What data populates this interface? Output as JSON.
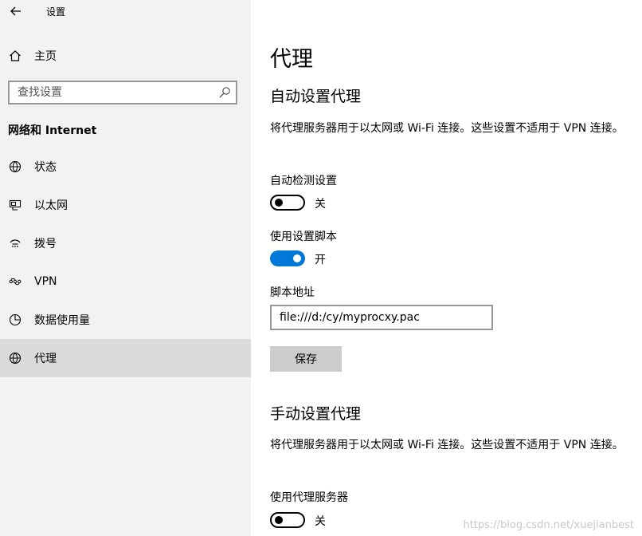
{
  "app": {
    "title": "设置"
  },
  "sidebar": {
    "home_label": "主页",
    "search_placeholder": "查找设置",
    "section_title": "网络和 Internet",
    "items": [
      {
        "label": "状态",
        "icon": "globe-status-icon"
      },
      {
        "label": "以太网",
        "icon": "ethernet-icon"
      },
      {
        "label": "拨号",
        "icon": "dialup-icon"
      },
      {
        "label": "VPN",
        "icon": "vpn-icon"
      },
      {
        "label": "数据使用量",
        "icon": "data-usage-icon"
      },
      {
        "label": "代理",
        "icon": "globe-icon",
        "active": true
      }
    ]
  },
  "main": {
    "title": "代理",
    "auto": {
      "heading": "自动设置代理",
      "description": "将代理服务器用于以太网或 Wi-Fi 连接。这些设置不适用于 VPN 连接。",
      "detect_label": "自动检测设置",
      "detect_state": "关",
      "script_label": "使用设置脚本",
      "script_state": "开",
      "address_label": "脚本地址",
      "address_value": "file:///d:/cy/myprocxy.pac",
      "save_label": "保存"
    },
    "manual": {
      "heading": "手动设置代理",
      "description": "将代理服务器用于以太网或 Wi-Fi 连接。这些设置不适用于 VPN 连接。",
      "proxy_label": "使用代理服务器",
      "proxy_state": "关"
    }
  },
  "colors": {
    "accent": "#0078d7",
    "sidebar_bg": "#f2f2f2",
    "active_bg": "#dadada"
  },
  "watermark": "https://blog.csdn.net/xuejianbest"
}
